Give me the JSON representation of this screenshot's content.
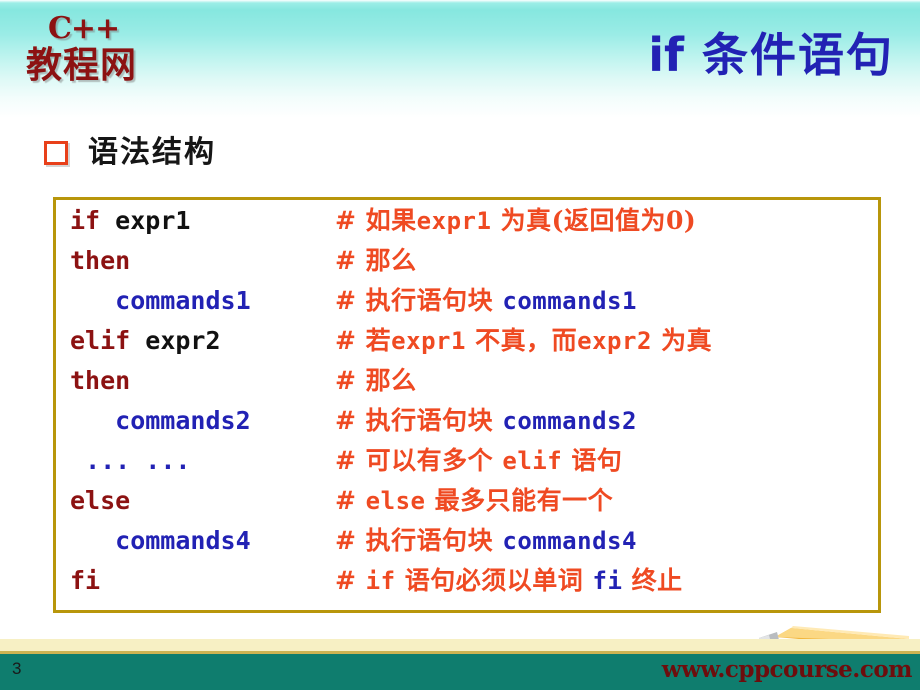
{
  "header": {
    "logo_top": "C++",
    "logo_bottom": "教程网",
    "title_keyword": "if",
    "title_text": "条件语句",
    "gradient_top_color": "#86e7df"
  },
  "section": {
    "bullet_color": "#e8401a",
    "label": "语法结构"
  },
  "code_box": {
    "border_color": "#b8960b",
    "keyword_color": "#8c1212",
    "variable_color": "#111111",
    "command_color": "#2222b4",
    "comment_color": "#ef4a22",
    "lines": [
      {
        "code_keyword": "if",
        "code_rest": " expr1",
        "code_indent": "",
        "comment_hash": "#",
        "comment_parts": [
          {
            "text": " 如果",
            "style": "cn"
          },
          {
            "text": "expr1",
            "style": "mono"
          },
          {
            "text": " 为真(返回值为0)",
            "style": "cn"
          }
        ]
      },
      {
        "code_keyword": "then",
        "code_rest": "",
        "code_indent": "",
        "comment_hash": "#",
        "comment_parts": [
          {
            "text": " 那么",
            "style": "cn"
          }
        ]
      },
      {
        "code_keyword": "",
        "code_rest": "commands1",
        "code_indent": "   ",
        "code_style": "command",
        "comment_hash": "#",
        "comment_parts": [
          {
            "text": " 执行语句块 ",
            "style": "cn"
          },
          {
            "text": "commands1",
            "style": "mono-blue"
          }
        ]
      },
      {
        "code_keyword": "elif",
        "code_rest": " expr2",
        "code_indent": "",
        "comment_hash": "#",
        "comment_parts": [
          {
            "text": " 若",
            "style": "cn"
          },
          {
            "text": "expr1",
            "style": "mono"
          },
          {
            "text": " 不真，而",
            "style": "cn"
          },
          {
            "text": "expr2",
            "style": "mono"
          },
          {
            "text": " 为真",
            "style": "cn"
          }
        ]
      },
      {
        "code_keyword": "then",
        "code_rest": "",
        "code_indent": "",
        "comment_hash": "#",
        "comment_parts": [
          {
            "text": " 那么",
            "style": "cn"
          }
        ]
      },
      {
        "code_keyword": "",
        "code_rest": "commands2",
        "code_indent": "   ",
        "code_style": "command",
        "comment_hash": "#",
        "comment_parts": [
          {
            "text": " 执行语句块 ",
            "style": "cn"
          },
          {
            "text": "commands2",
            "style": "mono-blue"
          }
        ]
      },
      {
        "code_keyword": "",
        "code_rest": "... ...",
        "code_indent": " ",
        "code_style": "command",
        "comment_hash": "#",
        "comment_parts": [
          {
            "text": " 可以有多个 ",
            "style": "cn"
          },
          {
            "text": "elif",
            "style": "mono-red"
          },
          {
            "text": " 语句",
            "style": "cn"
          }
        ]
      },
      {
        "code_keyword": "else",
        "code_rest": "",
        "code_indent": "",
        "comment_hash": "#",
        "comment_parts": [
          {
            "text": " ",
            "style": "cn"
          },
          {
            "text": "else",
            "style": "mono-red"
          },
          {
            "text": " 最多只能有一个",
            "style": "cn"
          }
        ]
      },
      {
        "code_keyword": "",
        "code_rest": "commands4",
        "code_indent": "   ",
        "code_style": "command",
        "comment_hash": "#",
        "comment_parts": [
          {
            "text": " 执行语句块 ",
            "style": "cn"
          },
          {
            "text": "commands4",
            "style": "mono-blue"
          }
        ]
      },
      {
        "code_keyword": "fi",
        "code_rest": "",
        "code_indent": "",
        "comment_hash": "#",
        "comment_parts": [
          {
            "text": " ",
            "style": "cn"
          },
          {
            "text": "if",
            "style": "mono-red"
          },
          {
            "text": " 语句必须以单词 ",
            "style": "cn"
          },
          {
            "text": "fi",
            "style": "mono-blue"
          },
          {
            "text": " 终止",
            "style": "cn"
          }
        ]
      }
    ]
  },
  "footer": {
    "page_number": "3",
    "site_url": "www.cppcourse.com",
    "band_color": "#0f7d6e",
    "cream_color": "#f7f0c4",
    "url_color": "#6d0d0d"
  }
}
